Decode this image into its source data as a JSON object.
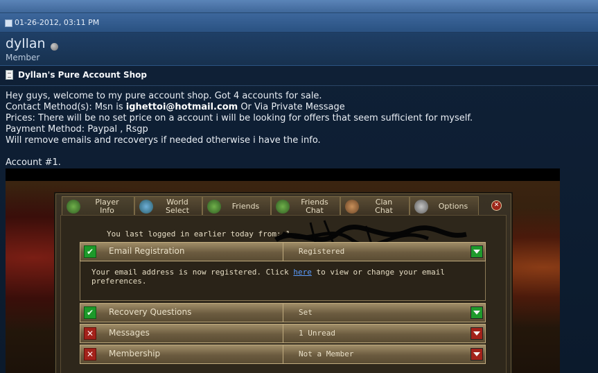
{
  "post": {
    "date": "01-26-2012, 03:11 PM",
    "username": "dyllan",
    "user_title": "Member",
    "title": "Dyllan's Pure Account Shop",
    "lines": {
      "l1": "Hey guys, welcome to my pure account shop. Got 4 accounts for sale.",
      "l2_pre": "Contact Method(s): Msn is ",
      "l2_email": "ighettoi@hotmail.com",
      "l2_post": " Or Via Private Message",
      "l3": "Prices: There will be no set price on a account i will be looking for offers that seem sufficient for myself.",
      "l4": "Payment Method: Paypal , Rsgp",
      "l5": "Will remove emails and recoverys if needed otherwise i have the info.",
      "l6": "Account #1."
    }
  },
  "game": {
    "tabs": {
      "player_info": "Player\nInfo",
      "world_select": "World\nSelect",
      "friends": "Friends",
      "friends_chat": "Friends\nChat",
      "clan_chat": "Clan\nChat",
      "options": "Options"
    },
    "last_login": "You last logged in earlier today from: 1",
    "rows": {
      "email": {
        "name": "Email Registration",
        "value": "Registered"
      },
      "recovery": {
        "name": "Recovery Questions",
        "value": "Set"
      },
      "messages": {
        "name": "Messages",
        "value": "1 Unread"
      },
      "membership": {
        "name": "Membership",
        "value": "Not a Member"
      }
    },
    "email_msg_pre": "Your email address is now registered. Click ",
    "email_msg_link": "here",
    "email_msg_post": " to view or change your email preferences.",
    "colors": {
      "accent_link": "#5a9cff",
      "ok": "#1d9a2a",
      "bad": "#a3221a"
    },
    "icons": {
      "ok": "check-icon",
      "bad": "x-icon",
      "close": "close-icon",
      "dropdown": "chevron-down-icon"
    }
  }
}
